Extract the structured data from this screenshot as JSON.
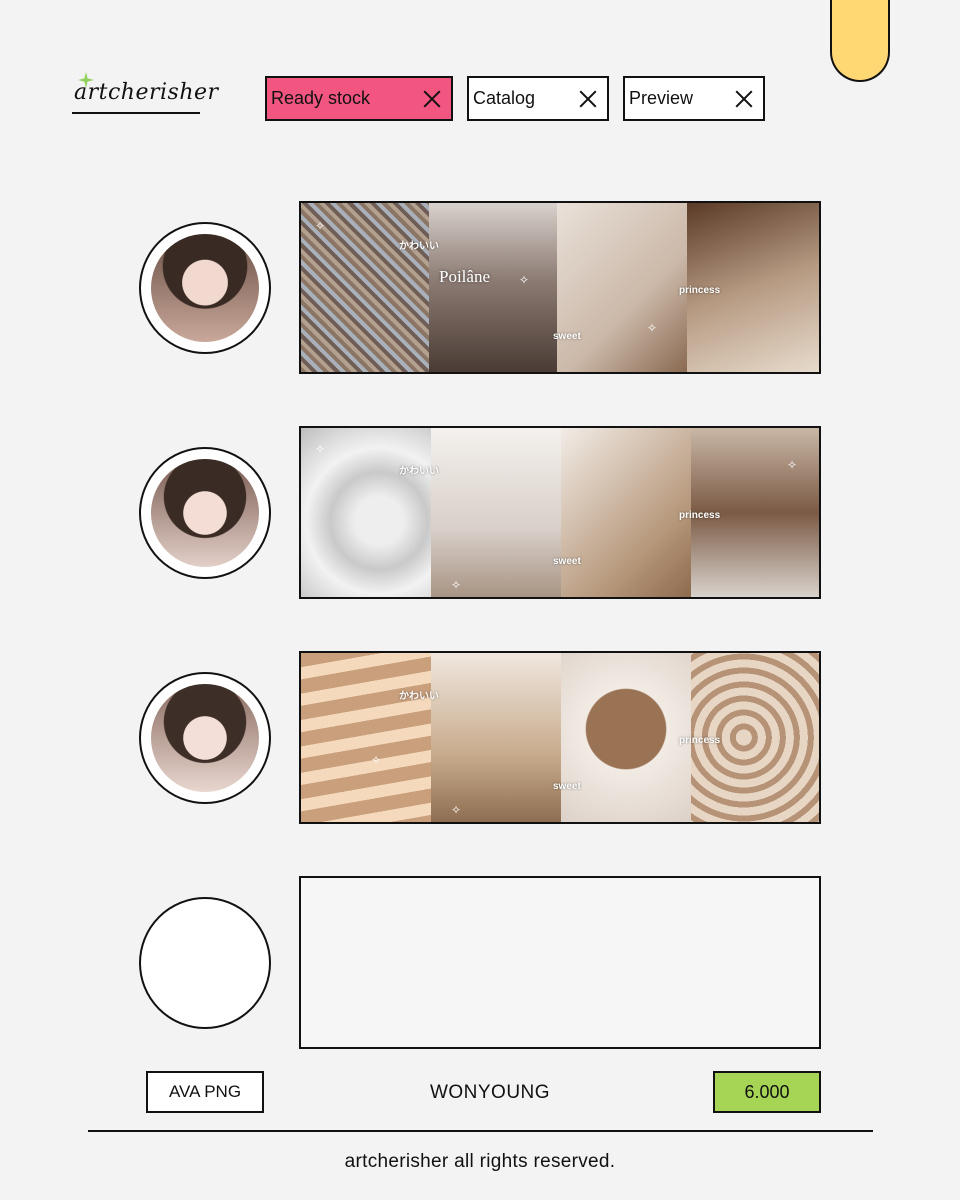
{
  "brand": {
    "logo_text": "artcherisher",
    "accent_star_color": "#8fd15a"
  },
  "tabs": [
    {
      "label": "Ready stock",
      "active": true
    },
    {
      "label": "Catalog",
      "active": false
    },
    {
      "label": "Preview",
      "active": false
    }
  ],
  "rows": [
    {
      "overlay_title": "Poilâne",
      "overlay_labels": [
        "かわいい",
        "princess",
        "sweet"
      ]
    },
    {
      "overlay_title": "",
      "overlay_labels": [
        "かわいい",
        "princess",
        "sweet"
      ]
    },
    {
      "overlay_title": "",
      "overlay_labels": [
        "かわいい",
        "princess",
        "sweet"
      ]
    },
    {
      "overlay_title": "",
      "overlay_labels": []
    }
  ],
  "product": {
    "type_label": "AVA PNG",
    "name": "WONYOUNG",
    "price": "6.000"
  },
  "footer": {
    "text": "artcherisher all rights reserved."
  },
  "colors": {
    "active_tab": "#f2557f",
    "price_bg": "#a6d454",
    "corner_tab": "#ffd874",
    "background": "#f3f3f3"
  }
}
